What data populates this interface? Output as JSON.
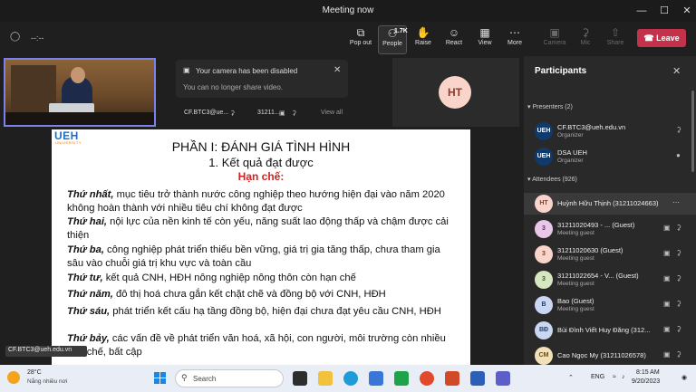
{
  "window": {
    "title": "Meeting now",
    "controls": [
      "minimize",
      "maximize",
      "close"
    ]
  },
  "toolbar": {
    "timer": "--:--",
    "buttons": [
      {
        "label": "Pop out",
        "icon": "pop-out-icon"
      },
      {
        "label": "People",
        "icon": "people-icon",
        "count": "1.7K"
      },
      {
        "label": "Raise",
        "icon": "raise-hand-icon"
      },
      {
        "label": "React",
        "icon": "react-icon"
      },
      {
        "label": "View",
        "icon": "view-icon"
      },
      {
        "label": "More",
        "icon": "more-icon"
      },
      {
        "label": "Camera",
        "icon": "camera-icon"
      },
      {
        "label": "Mic",
        "icon": "mic-icon"
      },
      {
        "label": "Share",
        "icon": "share-icon"
      }
    ],
    "leave": "Leave"
  },
  "toast": {
    "title": "Your camera has been disabled",
    "message": "You can no longer share video."
  },
  "tiles": {
    "tile1_label": "CF.BTC3@ue...",
    "tile2_label": "31211...",
    "view_all": "View all",
    "ht_initials": "HT"
  },
  "slide": {
    "logo": "UEH",
    "logo_sub": "UNIVERSITY",
    "title": "PHẦN I: ĐÁNH GIÁ TÌNH HÌNH",
    "subtitle": "1. Kết quả đạt được",
    "heading": "Hạn chế:",
    "items": [
      {
        "lead": "Thứ nhất,",
        "text": " mục tiêu trở thành nước công nghiệp theo hướng hiện đại vào năm 2020 không hoàn thành với nhiều tiêu chí không đạt được"
      },
      {
        "lead": "Thứ hai,",
        "text": " nội lực của nền kinh tế còn yếu, năng suất lao động thấp và chậm được cải thiện"
      },
      {
        "lead": "Thứ ba,",
        "text": " công nghiệp phát triển thiếu bền vững, giá trị gia tăng thấp, chưa tham gia sâu vào chuỗi giá trị khu vực và toàn cầu"
      },
      {
        "lead": "Thứ tư,",
        "text": " kết quả CNH, HĐH nông nghiệp nông thôn còn hạn chế"
      },
      {
        "lead": "Thứ năm,",
        "text": " đô thị hoá chưa gắn kết chặt chẽ và đồng bộ với CNH, HĐH"
      },
      {
        "lead": "Thứ sáu,",
        "text": " phát triển kết cấu hạ tầng đồng bộ, hiện đại chưa đạt yêu cầu CNH, HĐH"
      },
      {
        "lead": "Thứ bảy,",
        "text": " các vấn đề về phát triển văn hoá, xã hội, con người, môi trường còn nhiều hạn chế, bất cập"
      }
    ],
    "presenter_caption": "CF.BTC3@ueh.edu.vn"
  },
  "participants": {
    "title": "Participants",
    "presenters_header": "Presenters (2)",
    "attendees_header": "Attendees (926)",
    "presenters": [
      {
        "initials": "UEH",
        "name": "CF.BTC3@ueh.edu.vn",
        "role": "Organizer",
        "avatar_bg": "#0f3a6b",
        "avatar_fg": "#ffffff",
        "status_icon": "mic-off-icon"
      },
      {
        "initials": "UEH",
        "name": "DSA UEH",
        "role": "Organizer",
        "avatar_bg": "#0f3a6b",
        "avatar_fg": "#ffffff",
        "status_icon": "mic-icon"
      }
    ],
    "attendees": [
      {
        "initials": "HT",
        "name": "Huỳnh Hữu Thịnh (31211024663)",
        "role": "",
        "avatar_bg": "#f8d4cb",
        "avatar_fg": "#8a3b2a"
      },
      {
        "initials": "3",
        "name": "31211020493 - ... (Guest)",
        "role": "Meeting guest",
        "avatar_bg": "#e8c7e8",
        "avatar_fg": "#6b2a6b"
      },
      {
        "initials": "3",
        "name": "31211020630 (Guest)",
        "role": "Meeting guest",
        "avatar_bg": "#f8d4cb",
        "avatar_fg": "#8a3b2a"
      },
      {
        "initials": "3",
        "name": "31211022654 - V... (Guest)",
        "role": "Meeting guest",
        "avatar_bg": "#d6e8c2",
        "avatar_fg": "#3d5a1e"
      },
      {
        "initials": "B",
        "name": "Bao (Guest)",
        "role": "Meeting guest",
        "avatar_bg": "#c9d7f2",
        "avatar_fg": "#233f75"
      },
      {
        "initials": "BĐ",
        "name": "Bùi Đình Viết Huy Đăng (312...",
        "role": "",
        "avatar_bg": "#c9d7f2",
        "avatar_fg": "#233f75"
      },
      {
        "initials": "CM",
        "name": "Cao Ngọc My (31211026578)",
        "role": "",
        "avatar_bg": "#f1e0b8",
        "avatar_fg": "#6b4a10"
      }
    ]
  },
  "taskbar": {
    "weather_temp": "28°C",
    "weather_desc": "Nắng nhiều nơi",
    "search_placeholder": "Search",
    "language": "ENG",
    "time": "8:15 AM",
    "date": "9/20/2023"
  }
}
